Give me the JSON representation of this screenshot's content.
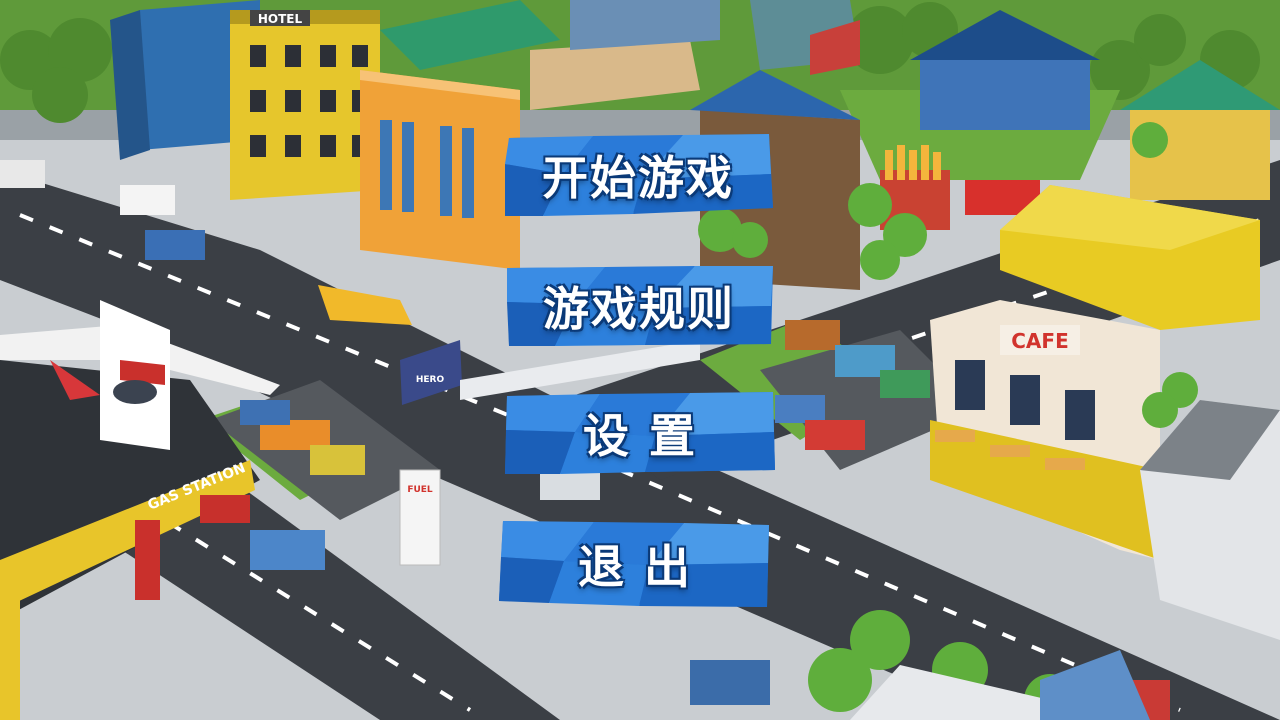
{
  "menu": {
    "start_label": "开始游戏",
    "rules_label": "游戏规则",
    "settings_label": "设    置",
    "exit_label": "退    出"
  },
  "scene": {
    "hotel_sign": "HOTEL",
    "cafe_sign": "CAFE",
    "gas_station_sign": "GAS STATION",
    "fuel_sign": "FUEL",
    "billboard_text": "HERO"
  },
  "colors": {
    "button_blue": "#1f6fd0",
    "button_light": "#5aa8f0",
    "road": "#3b3f45",
    "sidewalk": "#d9dcdf",
    "grass": "#6cab3f"
  }
}
